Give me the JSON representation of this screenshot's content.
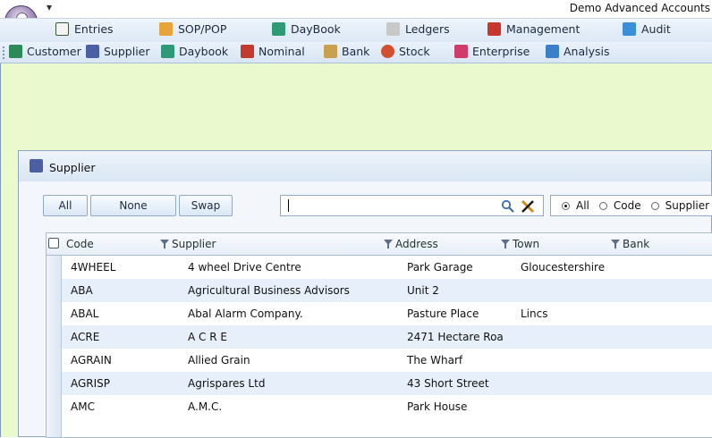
{
  "app": {
    "title": "Demo Advanced Accounts",
    "quick_access_glyph": "▾"
  },
  "menu": {
    "items": [
      {
        "label": "Entries",
        "icon": "entries-icon",
        "color": "#3a5a3a"
      },
      {
        "label": "SOP/POP",
        "icon": "sop-pop-icon",
        "color": "#e8a33a"
      },
      {
        "label": "DayBook",
        "icon": "daybook-icon",
        "color": "#2f9a76"
      },
      {
        "label": "Ledgers",
        "icon": "ledgers-icon",
        "color": "#b8b8b8"
      },
      {
        "label": "Management",
        "icon": "management-icon",
        "color": "#c8372d"
      },
      {
        "label": "Audit",
        "icon": "audit-icon",
        "color": "#3a8fd8"
      }
    ]
  },
  "toolbar": {
    "items": [
      {
        "label": "Customer",
        "icon": "customer-icon",
        "color": "#2f8a5a"
      },
      {
        "label": "Supplier",
        "icon": "supplier-icon",
        "color": "#4b5fa3"
      },
      {
        "label": "Daybook",
        "icon": "daybook-icon",
        "color": "#2f9a76"
      },
      {
        "label": "Nominal",
        "icon": "nominal-icon",
        "color": "#c43a2f"
      },
      {
        "label": "Bank",
        "icon": "bank-icon",
        "color": "#c9a050"
      },
      {
        "label": "Stock",
        "icon": "stock-icon",
        "color": "#d0502f"
      },
      {
        "label": "Enterprise",
        "icon": "enterprise-icon",
        "color": "#d23a6a"
      },
      {
        "label": "Analysis",
        "icon": "analysis-icon",
        "color": "#3a7fc8"
      }
    ]
  },
  "supplier_window": {
    "title": "Supplier",
    "buttons": {
      "all": "All",
      "none": "None",
      "swap": "Swap"
    },
    "search_value": "",
    "radios": [
      {
        "label": "All",
        "selected": true
      },
      {
        "label": "Code",
        "selected": false
      },
      {
        "label": "Supplier",
        "selected": false
      }
    ],
    "columns": [
      "Code",
      "Supplier",
      "Address",
      "Town",
      "Bank"
    ],
    "rows": [
      {
        "code": "4WHEEL",
        "supplier": "4 wheel Drive Centre",
        "address": "Park Garage",
        "town": "Gloucestershire",
        "bank": ""
      },
      {
        "code": "ABA",
        "supplier": "Agricultural Business Advisors",
        "address": "Unit 2",
        "town": "",
        "bank": ""
      },
      {
        "code": "ABAL",
        "supplier": "Abal Alarm Company.",
        "address": "Pasture Place",
        "town": "Lincs",
        "bank": ""
      },
      {
        "code": "ACRE",
        "supplier": "A C R E",
        "address": "2471 Hectare Roa",
        "town": "",
        "bank": ""
      },
      {
        "code": "AGRAIN",
        "supplier": "Allied Grain",
        "address": "The Wharf",
        "town": "",
        "bank": ""
      },
      {
        "code": "AGRISP",
        "supplier": "Agrispares Ltd",
        "address": "43 Short Street",
        "town": "",
        "bank": ""
      },
      {
        "code": "AMC",
        "supplier": "A.M.C.",
        "address": "Park House",
        "town": "",
        "bank": ""
      }
    ]
  }
}
